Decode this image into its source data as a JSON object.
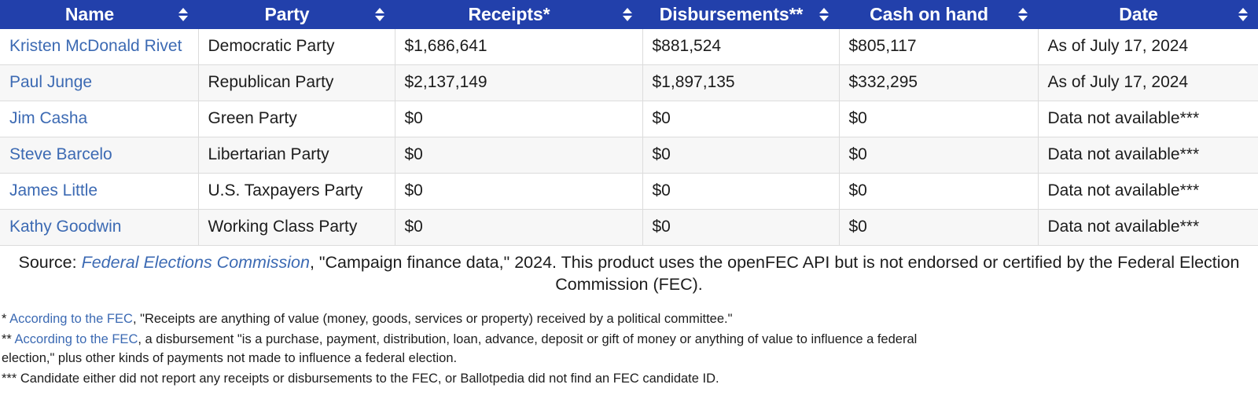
{
  "table": {
    "columns": [
      {
        "label": "Name",
        "sortable": true,
        "sort_icon": "sort-updown-icon"
      },
      {
        "label": "Party",
        "sortable": true,
        "sort_icon": "sort-updown-icon"
      },
      {
        "label": "Receipts*",
        "sortable": true,
        "sort_icon": "sort-updown-icon"
      },
      {
        "label": "Disbursements**",
        "sortable": true,
        "sort_icon": "sort-updown-icon"
      },
      {
        "label": "Cash on hand",
        "sortable": true,
        "sort_icon": "sort-updown-icon"
      },
      {
        "label": "Date",
        "sortable": true,
        "sort_icon": "sort-updown-icon"
      }
    ],
    "rows": [
      {
        "name": "Kristen McDonald Rivet",
        "party": "Democratic Party",
        "receipts": "$1,686,641",
        "disbursements": "$881,524",
        "cash_on_hand": "$805,117",
        "date": "As of July 17, 2024"
      },
      {
        "name": "Paul Junge",
        "party": "Republican Party",
        "receipts": "$2,137,149",
        "disbursements": "$1,897,135",
        "cash_on_hand": "$332,295",
        "date": "As of July 17, 2024"
      },
      {
        "name": "Jim Casha",
        "party": "Green Party",
        "receipts": "$0",
        "disbursements": "$0",
        "cash_on_hand": "$0",
        "date": "Data not available***"
      },
      {
        "name": "Steve Barcelo",
        "party": "Libertarian Party",
        "receipts": "$0",
        "disbursements": "$0",
        "cash_on_hand": "$0",
        "date": "Data not available***"
      },
      {
        "name": "James Little",
        "party": "U.S. Taxpayers Party",
        "receipts": "$0",
        "disbursements": "$0",
        "cash_on_hand": "$0",
        "date": "Data not available***"
      },
      {
        "name": "Kathy Goodwin",
        "party": "Working Class Party",
        "receipts": "$0",
        "disbursements": "$0",
        "cash_on_hand": "$0",
        "date": "Data not available***"
      }
    ]
  },
  "source": {
    "prefix": "Source: ",
    "link_text": "Federal Elections Commission",
    "suffix": ", \"Campaign finance data,\" 2024. This product uses the openFEC API but is not endorsed or certified by the Federal Election Commission (FEC)."
  },
  "notes": [
    {
      "marker": "* ",
      "link_text": "According to the FEC",
      "text": ", \"Receipts are anything of value (money, goods, services or property) received by a political committee.\""
    },
    {
      "marker": "** ",
      "link_text": "According to the FEC",
      "text": ", a disbursement \"is a purchase, payment, distribution, loan, advance, deposit or gift of money or anything of value to influence a federal election,\" plus other kinds of payments not made to influence a federal election."
    },
    {
      "marker": "*** ",
      "link_text": "",
      "text": "Candidate either did not report any receipts or disbursements to the FEC, or Ballotpedia did not find an FEC candidate ID."
    }
  ],
  "colors": {
    "header_bg": "#2240ab",
    "header_text": "#ffffff",
    "link": "#3c6ab3",
    "row_alt_bg": "#f7f7f7",
    "border": "#dcdcdc"
  }
}
